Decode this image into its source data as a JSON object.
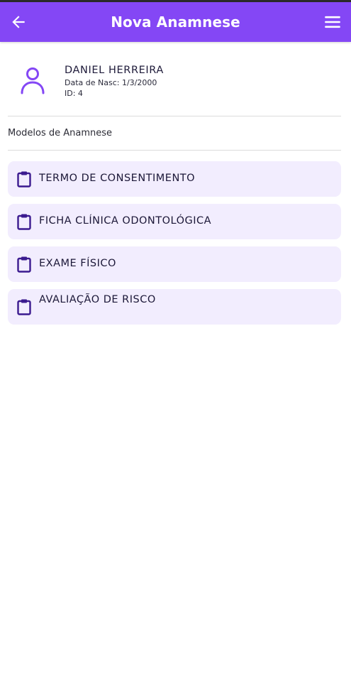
{
  "header": {
    "title": "Nova Anamnese",
    "back_icon": "arrow-left-icon",
    "menu_icon": "hamburger-menu-icon",
    "background_color": "#8447f5"
  },
  "patient": {
    "name": "DANIEL HERREIRA",
    "birth_date": "Data de Nasc: 1/3/2000",
    "id": "ID: 4",
    "avatar_icon": "person-outline-icon",
    "accent_color": "#8447f5"
  },
  "section": {
    "label": "Modelos de Anamnese"
  },
  "models": [
    {
      "label": "TERMO DE CONSENTIMENTO",
      "icon": "clipboard-icon"
    },
    {
      "label": "FICHA CLÍNICA ODONTOLÓGICA",
      "icon": "clipboard-icon"
    },
    {
      "label": "EXAME FÍSICO",
      "icon": "clipboard-icon"
    },
    {
      "label": "AVALIAÇÃO DE RISCO",
      "icon": "clipboard-icon"
    }
  ],
  "colors": {
    "card_background": "#f2edfe",
    "icon_color": "#3b1a8f"
  }
}
